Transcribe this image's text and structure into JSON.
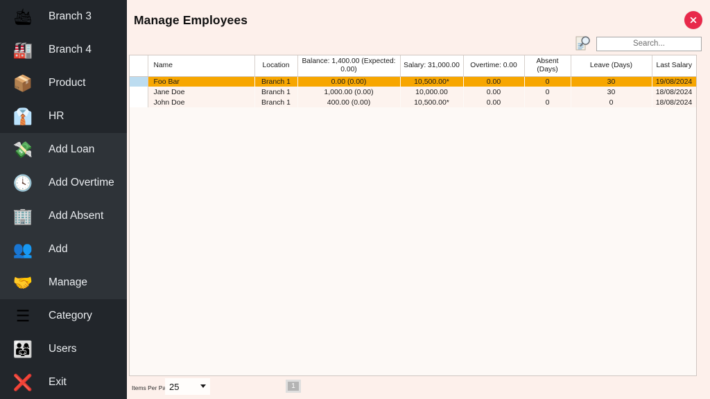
{
  "sidebar": {
    "groups": [
      {
        "active": false,
        "items": [
          {
            "label": "Branch 3",
            "icon": "ship-location-icon",
            "glyph": "🛳"
          },
          {
            "label": "Branch 4",
            "icon": "factory-crane-icon",
            "glyph": "🏭"
          },
          {
            "label": "Product",
            "icon": "boxes-icon",
            "glyph": "📦"
          },
          {
            "label": "HR",
            "icon": "hr-desk-icon",
            "glyph": "👔"
          }
        ]
      },
      {
        "active": true,
        "items": [
          {
            "label": "Add Loan",
            "icon": "network-money-icon",
            "glyph": "💸"
          },
          {
            "label": "Add Overtime",
            "icon": "clock-icon",
            "glyph": "🕓"
          },
          {
            "label": "Add Absent",
            "icon": "absent-building-icon",
            "glyph": "🏢"
          },
          {
            "label": "Add",
            "icon": "add-person-icon",
            "glyph": "👥"
          },
          {
            "label": "Manage",
            "icon": "manage-people-icon",
            "glyph": "🤝"
          }
        ]
      },
      {
        "active": false,
        "items": [
          {
            "label": "Category",
            "icon": "list-icon",
            "glyph": "☰"
          },
          {
            "label": "Users",
            "icon": "users-icon",
            "glyph": "👨‍👩‍👧"
          },
          {
            "label": "Exit",
            "icon": "exit-close-icon",
            "glyph": "❌"
          }
        ]
      }
    ]
  },
  "header": {
    "title": "Manage Employees",
    "close_icon": "close-icon"
  },
  "search": {
    "icon": "document-search-icon",
    "value": "",
    "placeholder": "Search..."
  },
  "table": {
    "columns": [
      {
        "key": "sel",
        "label": ""
      },
      {
        "key": "name",
        "label": "Name"
      },
      {
        "key": "location",
        "label": "Location"
      },
      {
        "key": "balance",
        "label": "Balance: 1,400.00 (Expected: 0.00)"
      },
      {
        "key": "salary",
        "label": "Salary: 31,000.00"
      },
      {
        "key": "overtime",
        "label": "Overtime: 0.00"
      },
      {
        "key": "absent",
        "label": "Absent (Days)"
      },
      {
        "key": "leave",
        "label": "Leave (Days)"
      },
      {
        "key": "last_salary",
        "label": "Last Salary"
      }
    ],
    "rows": [
      {
        "selected": true,
        "name": "Foo Bar",
        "location": "Branch 1",
        "balance": "0.00 (0.00)",
        "salary": "10,500.00*",
        "overtime": "0.00",
        "absent": "0",
        "leave": "30",
        "last_salary": "19/08/2024"
      },
      {
        "selected": false,
        "name": "Jane Doe",
        "location": "Branch 1",
        "balance": "1,000.00 (0.00)",
        "salary": "10,000.00",
        "overtime": "0.00",
        "absent": "0",
        "leave": "30",
        "last_salary": "18/08/2024"
      },
      {
        "selected": false,
        "name": "John Doe",
        "location": "Branch 1",
        "balance": "400.00 (0.00)",
        "salary": "10,500.00*",
        "overtime": "0.00",
        "absent": "0",
        "leave": "0",
        "last_salary": "18/08/2024"
      }
    ]
  },
  "footer": {
    "items_per_page_label": "Items Per Page",
    "items_per_page_value": "25",
    "page_button_label": "1"
  },
  "colors": {
    "sidebar_bg": "#22262b",
    "sidebar_active_bg": "#2e3338",
    "main_bg": "#fdf0eb",
    "row_selected": "#f7a600",
    "row_selector_selected": "#bcdcf0",
    "close_red": "#e8294a",
    "grid_bg": "#fdf9f6"
  }
}
